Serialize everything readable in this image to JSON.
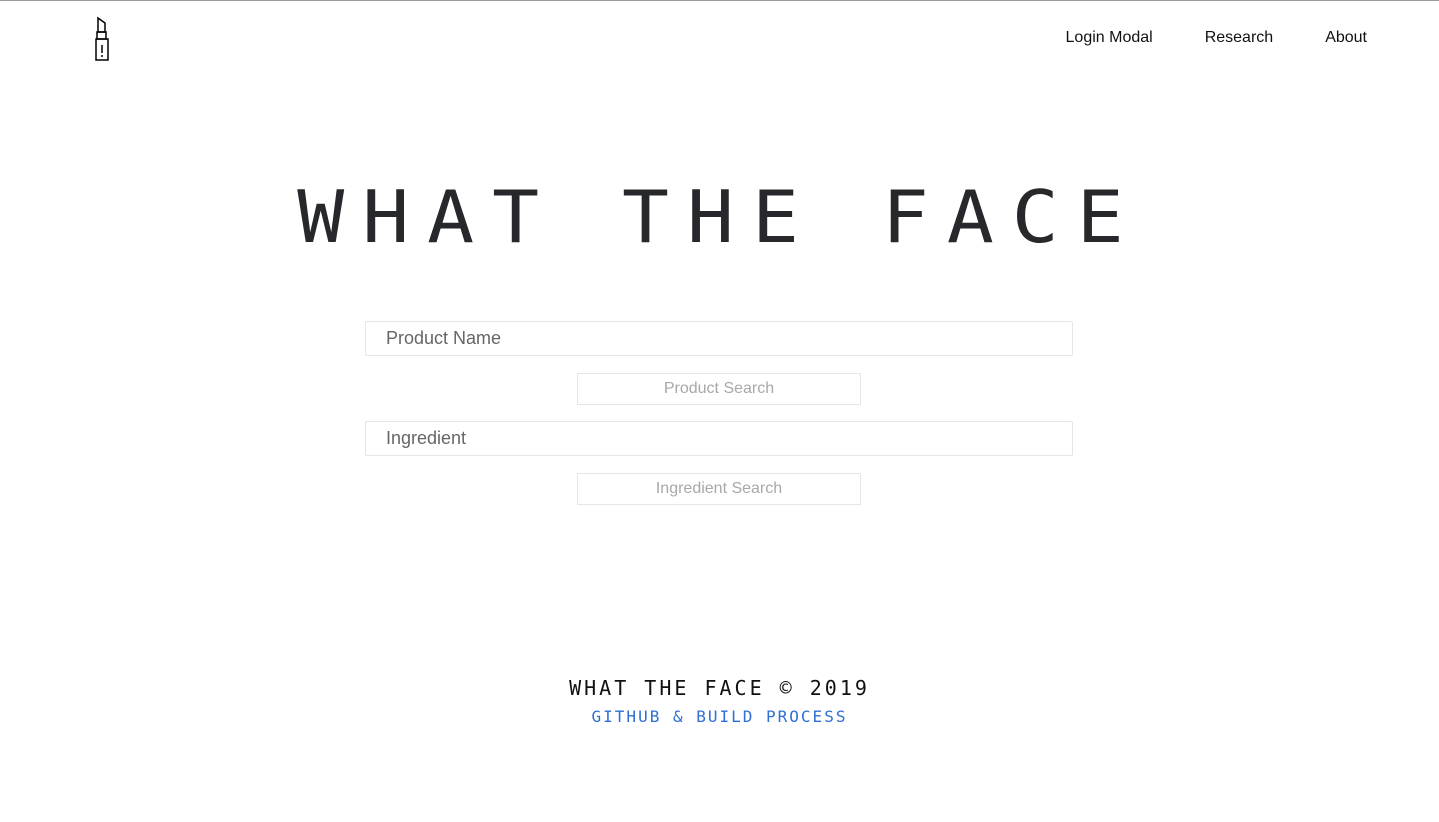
{
  "header": {
    "logo_icon": "lipstick-icon",
    "nav": [
      {
        "label": "Login Modal"
      },
      {
        "label": "Research"
      },
      {
        "label": "About"
      }
    ]
  },
  "hero": {
    "title": "WHAT THE FACE"
  },
  "search": {
    "product_placeholder": "Product Name",
    "product_button": "Product Search",
    "ingredient_placeholder": "Ingredient",
    "ingredient_button": "Ingredient Search"
  },
  "footer": {
    "title": "WHAT THE FACE © 2019",
    "link": "GITHUB & BUILD PROCESS"
  },
  "colors": {
    "text": "#222222",
    "link": "#2f6fd6",
    "button_text": "#a8a8a8",
    "border": "#e6e6e6"
  }
}
